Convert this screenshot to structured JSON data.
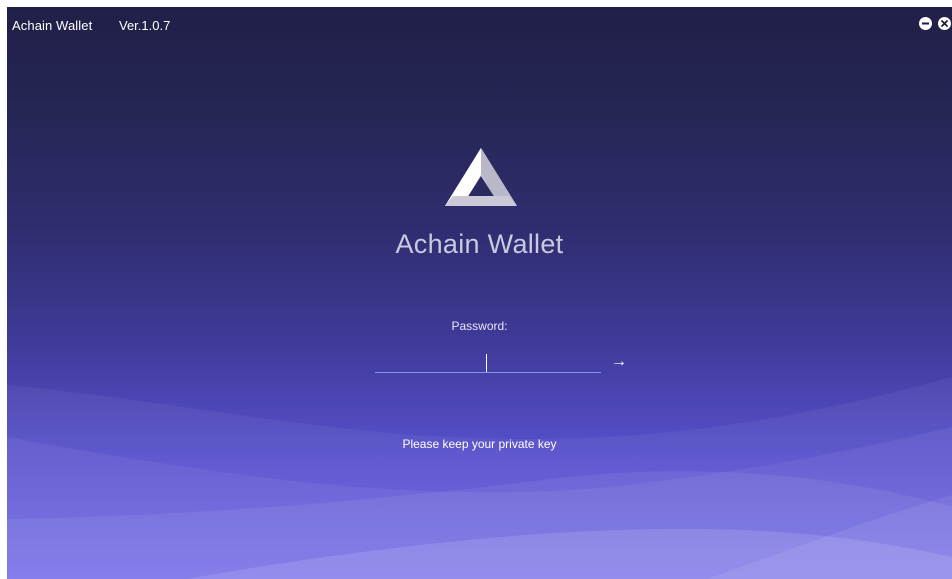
{
  "titlebar": {
    "app_name": "Achain Wallet",
    "version": "Ver.1.0.7",
    "minimize_icon": "minimize-icon",
    "close_icon": "close-icon"
  },
  "main": {
    "logo_icon": "achain-triangle-logo",
    "product_title": "Achain Wallet",
    "password_label": "Password:",
    "password_value": "",
    "submit_icon": "arrow-right-icon",
    "submit_glyph": "→",
    "hint": "Please keep your private key"
  },
  "colors": {
    "background_top": "#1f1f47",
    "background_bottom": "#6e66e8",
    "input_underline": "#8f95e6",
    "text": "#ffffff"
  }
}
